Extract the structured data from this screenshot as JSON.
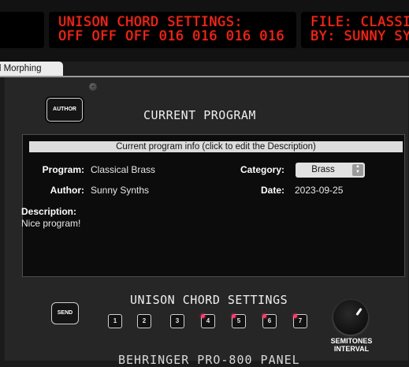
{
  "lcd": {
    "main_line1": "UNISON CHORD SETTINGS:",
    "main_line2": "OFF OFF OFF 016 016 016 016",
    "file_line1": "FILE: CLASSI",
    "file_line2": "BY: SUNNY SY"
  },
  "tab": {
    "label": "d Morphing"
  },
  "author_button": "AUTHOR",
  "current_program": {
    "title": "CURRENT PROGRAM",
    "info_header": "Current program info (click to edit the Description)",
    "program_label": "Program:",
    "program_value": "Classical Brass",
    "author_label": "Author:",
    "author_value": "Sunny Synths",
    "category_label": "Category:",
    "category_value": "Brass",
    "date_label": "Date:",
    "date_value": "2023-09-25",
    "description_label": "Description:",
    "description_value": "Nice program!"
  },
  "unison": {
    "title": "UNISON CHORD SETTINGS",
    "send_label": "SEND",
    "voices": [
      {
        "label": "1",
        "active": false
      },
      {
        "label": "2",
        "active": false
      },
      {
        "label": "3",
        "active": false
      },
      {
        "label": "4",
        "active": true
      },
      {
        "label": "5",
        "active": true
      },
      {
        "label": "6",
        "active": true
      },
      {
        "label": "7",
        "active": true
      }
    ],
    "knob_label_line1": "SEMITONES",
    "knob_label_line2": "INTERVAL"
  },
  "brand": "BEHRINGER PRO-800 PANEL",
  "colors": {
    "lcd_text": "#ff2a1a",
    "led_on": "#ff3a6e",
    "panel_bg": "#262626"
  }
}
